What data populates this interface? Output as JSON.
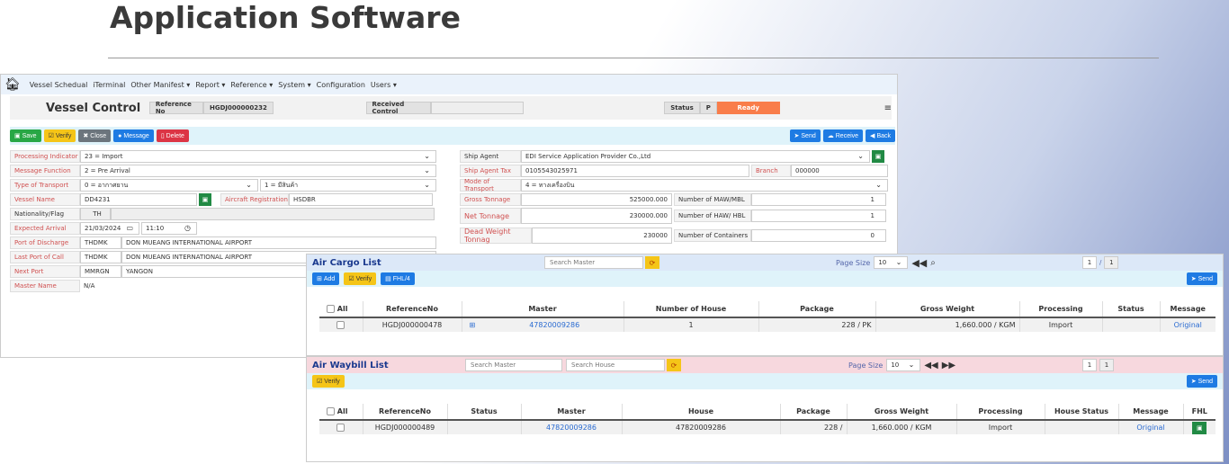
{
  "slide_title": "Application Software",
  "nav": {
    "items": [
      "Vessel Schedual",
      "iTerminal",
      "Other Manifest ▾",
      "Report ▾",
      "Reference ▾",
      "System ▾",
      "Configuration",
      "Users ▾"
    ]
  },
  "header": {
    "title": "Vessel Control",
    "ref_label": "Reference No",
    "ref_value": "HGDJ000000232",
    "received_label": "Received Control",
    "status_label": "Status",
    "status_code": "P",
    "status_text": "Ready",
    "status_color": "#f97d4a"
  },
  "toolbar": {
    "save": "Save",
    "verify": "Verify",
    "close": "Close",
    "message": "Message",
    "delete": "Delete",
    "send": "Send",
    "receive": "Receive",
    "back": "Back"
  },
  "form": {
    "processing_indicator_label": "Processing Indicator",
    "processing_indicator": "23 = Import",
    "message_function_label": "Message Function",
    "message_function": "2 = Pre Arrival",
    "type_transport_label": "Type of Transport",
    "type_transport": "0 = อากาศยาน",
    "type_transport2": "1 = มีสินค้า",
    "vessel_name_label": "Vessel Name",
    "vessel_name": "DD4231",
    "aircraft_reg_label": "Aircraft Registration",
    "aircraft_reg": "HSDBR",
    "nationality_label": "Nationality/Flag",
    "nationality": "TH",
    "expected_arrival_label": "Expected Arrival",
    "arrival_date": "21/03/2024",
    "arrival_time": "11:10",
    "port_discharge_label": "Port of Discharge",
    "port_discharge_code": "THDMK",
    "port_discharge_name": "DON MUEANG INTERNATIONAL AIRPORT",
    "last_port_label": "Last Port of Call",
    "last_port_code": "THDMK",
    "last_port_name": "DON MUEANG INTERNATIONAL AIRPORT",
    "next_port_label": "Next Port",
    "next_port_code": "MMRGN",
    "next_port_name": "YANGON",
    "master_name_label": "Master Name",
    "master_name": "N/A",
    "ship_agent_label": "Ship Agent",
    "ship_agent": "EDI Service Application Provider Co.,Ltd",
    "ship_agent_tax_label": "Ship Agent Tax",
    "ship_agent_tax": "0105543025971",
    "branch_label": "Branch",
    "branch": "000000",
    "mode_transport_label": "Mode of Transport",
    "mode_transport": "4 = ทางเครื่องบิน",
    "gross_tonnage_label": "Gross Tonnage",
    "gross_tonnage": "525000.000",
    "maw_label": "Number of MAW/MBL",
    "maw": "1",
    "net_tonnage_label": "Net Tonnage",
    "net_tonnage": "230000.000",
    "haw_label": "Number of HAW/ HBL",
    "haw": "1",
    "dead_weight_label": "Dead Weight Tonnag",
    "dead_weight": "230000",
    "containers_label": "Number of Containers",
    "containers": "0"
  },
  "air_cargo": {
    "title": "Air Cargo List",
    "search_placeholder": "Search Master",
    "page_size_label": "Page Size",
    "page_size": "10",
    "page": "1",
    "pages": "1",
    "add": "Add",
    "verify": "Verify",
    "fhl": "FHL/4",
    "send": "Send",
    "columns": [
      "All",
      "ReferenceNo",
      "Master",
      "Number of House",
      "Package",
      "Gross Weight",
      "Processing",
      "Status",
      "Message"
    ],
    "rows": [
      {
        "ref": "HGDJ000000478",
        "master": "47820009286",
        "houses": "1",
        "package": "228 / PK",
        "gross": "1,660.000 / KGM",
        "processing": "Import",
        "status": "",
        "message": "Original"
      }
    ]
  },
  "air_waybill": {
    "title": "Air Waybill List",
    "search_master": "Search Master",
    "search_house": "Search House",
    "page_size_label": "Page Size",
    "page_size": "10",
    "page": "1",
    "pages": "1",
    "verify": "Verify",
    "send": "Send",
    "columns": [
      "All",
      "ReferenceNo",
      "Status",
      "Master",
      "House",
      "Package",
      "Gross Weight",
      "Processing",
      "House Status",
      "Message",
      "FHL"
    ],
    "rows": [
      {
        "ref": "HGDJ000000489",
        "status": "",
        "master": "47820009286",
        "house": "47820009286",
        "package": "228 /",
        "gross": "1,660.000 / KGM",
        "processing": "Import",
        "house_status": "",
        "message": "Original"
      }
    ]
  }
}
